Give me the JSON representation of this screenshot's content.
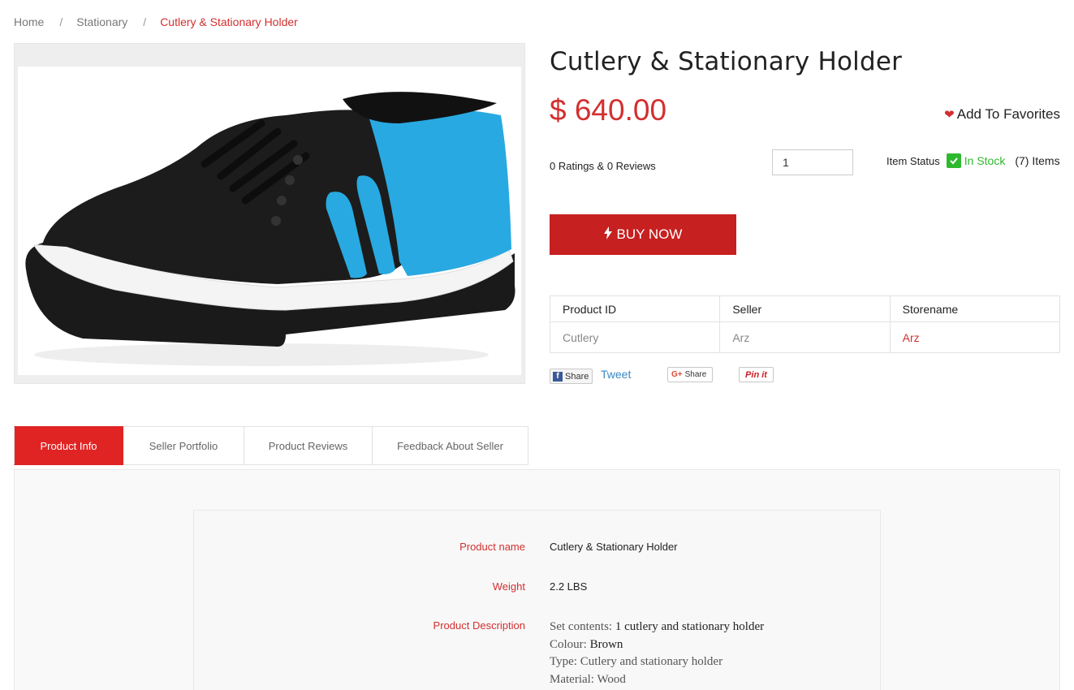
{
  "breadcrumb": {
    "home": "Home",
    "category": "Stationary",
    "current": "Cutlery & Stationary Holder",
    "separator": "/"
  },
  "product": {
    "title": "Cutlery & Stationary Holder",
    "price": "$ 640.00",
    "favorites_label": "Add To Favorites",
    "ratings": "0 Ratings & 0 Reviews",
    "quantity": "1",
    "item_status_label": "Item Status",
    "stock_text": "In Stock",
    "items_count": "(7) Items",
    "buy_label": "BUY NOW",
    "image_icon": "sneaker-product-photo"
  },
  "info_table": {
    "headers": [
      "Product ID",
      "Seller",
      "Storename"
    ],
    "values": [
      "Cutlery",
      "Arz",
      "Arz"
    ]
  },
  "social": {
    "fb_share": "Share",
    "tweet": "Tweet",
    "gplus_share": "Share",
    "pin": "Pin it"
  },
  "tabs": [
    {
      "label": "Product Info",
      "active": true
    },
    {
      "label": "Seller Portfolio",
      "active": false
    },
    {
      "label": "Product Reviews",
      "active": false
    },
    {
      "label": "Feedback About Seller",
      "active": false
    }
  ],
  "details": {
    "name_label": "Product name",
    "name_value": "Cutlery & Stationary Holder",
    "weight_label": "Weight",
    "weight_value": "2.2 LBS",
    "desc_label": "Product Description",
    "desc_lines": [
      {
        "key": "Set contents:",
        "value": "1 cutlery and stationary holder"
      },
      {
        "key": "Colour:",
        "value": "Brown"
      },
      {
        "key": "Type:",
        "value": "Cutlery and stationary holder"
      },
      {
        "key": "Material:",
        "value": "Wood"
      }
    ]
  },
  "colors": {
    "accent": "#d32f2f",
    "buy_button": "#c62020",
    "in_stock": "#2eb82e",
    "tweet": "#3b88c3"
  }
}
